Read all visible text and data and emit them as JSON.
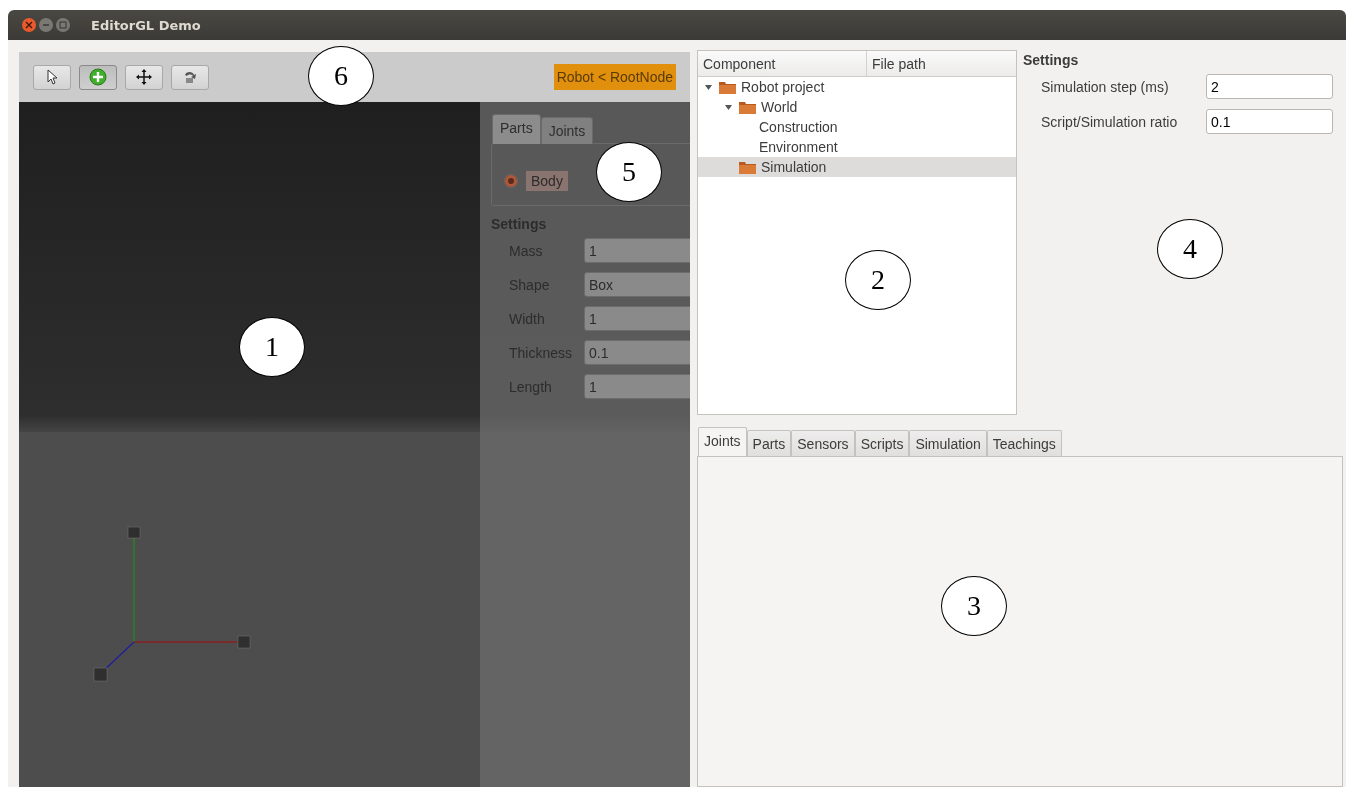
{
  "window": {
    "title": "EditorGL Demo"
  },
  "toolbar": {
    "tools": [
      {
        "kind": "pointer",
        "selected": false
      },
      {
        "kind": "add",
        "selected": true
      },
      {
        "kind": "move",
        "selected": false
      },
      {
        "kind": "rotate",
        "selected": false
      }
    ],
    "node_path": "Robot < RootNode"
  },
  "overlay": {
    "tabs": [
      {
        "label": "Parts",
        "selected": true
      },
      {
        "label": "Joints",
        "selected": false
      }
    ],
    "parts": [
      {
        "label": "Body",
        "selected": true
      }
    ],
    "settings_title": "Settings",
    "fields": [
      {
        "label": "Mass",
        "value": "1"
      },
      {
        "label": "Shape",
        "value": "Box"
      },
      {
        "label": "Width",
        "value": "1"
      },
      {
        "label": "Thickness",
        "value": "0.1"
      },
      {
        "label": "Length",
        "value": "1"
      }
    ]
  },
  "tree": {
    "columns": [
      "Component",
      "File path"
    ],
    "items": [
      {
        "label": "Robot project",
        "folder": true,
        "expanded": true,
        "selected": false,
        "children": [
          {
            "label": "World",
            "folder": true,
            "expanded": true,
            "selected": false,
            "children": [
              {
                "label": "Construction",
                "folder": false,
                "selected": false
              },
              {
                "label": "Environment",
                "folder": false,
                "selected": false
              }
            ]
          },
          {
            "label": "Simulation",
            "folder": true,
            "selected": true
          }
        ]
      }
    ]
  },
  "settings": {
    "title": "Settings",
    "fields": [
      {
        "label": "Simulation step (ms)",
        "value": "2"
      },
      {
        "label": "Script/Simulation ratio",
        "value": "0.1"
      }
    ]
  },
  "bottom_tabs": [
    {
      "label": "Joints",
      "selected": true
    },
    {
      "label": "Parts",
      "selected": false
    },
    {
      "label": "Sensors",
      "selected": false
    },
    {
      "label": "Scripts",
      "selected": false
    },
    {
      "label": "Simulation",
      "selected": false
    },
    {
      "label": "Teachings",
      "selected": false
    }
  ],
  "callouts": [
    {
      "label": "6"
    },
    {
      "label": "5"
    },
    {
      "label": "1"
    },
    {
      "label": "2"
    },
    {
      "label": "4"
    },
    {
      "label": "3"
    }
  ]
}
